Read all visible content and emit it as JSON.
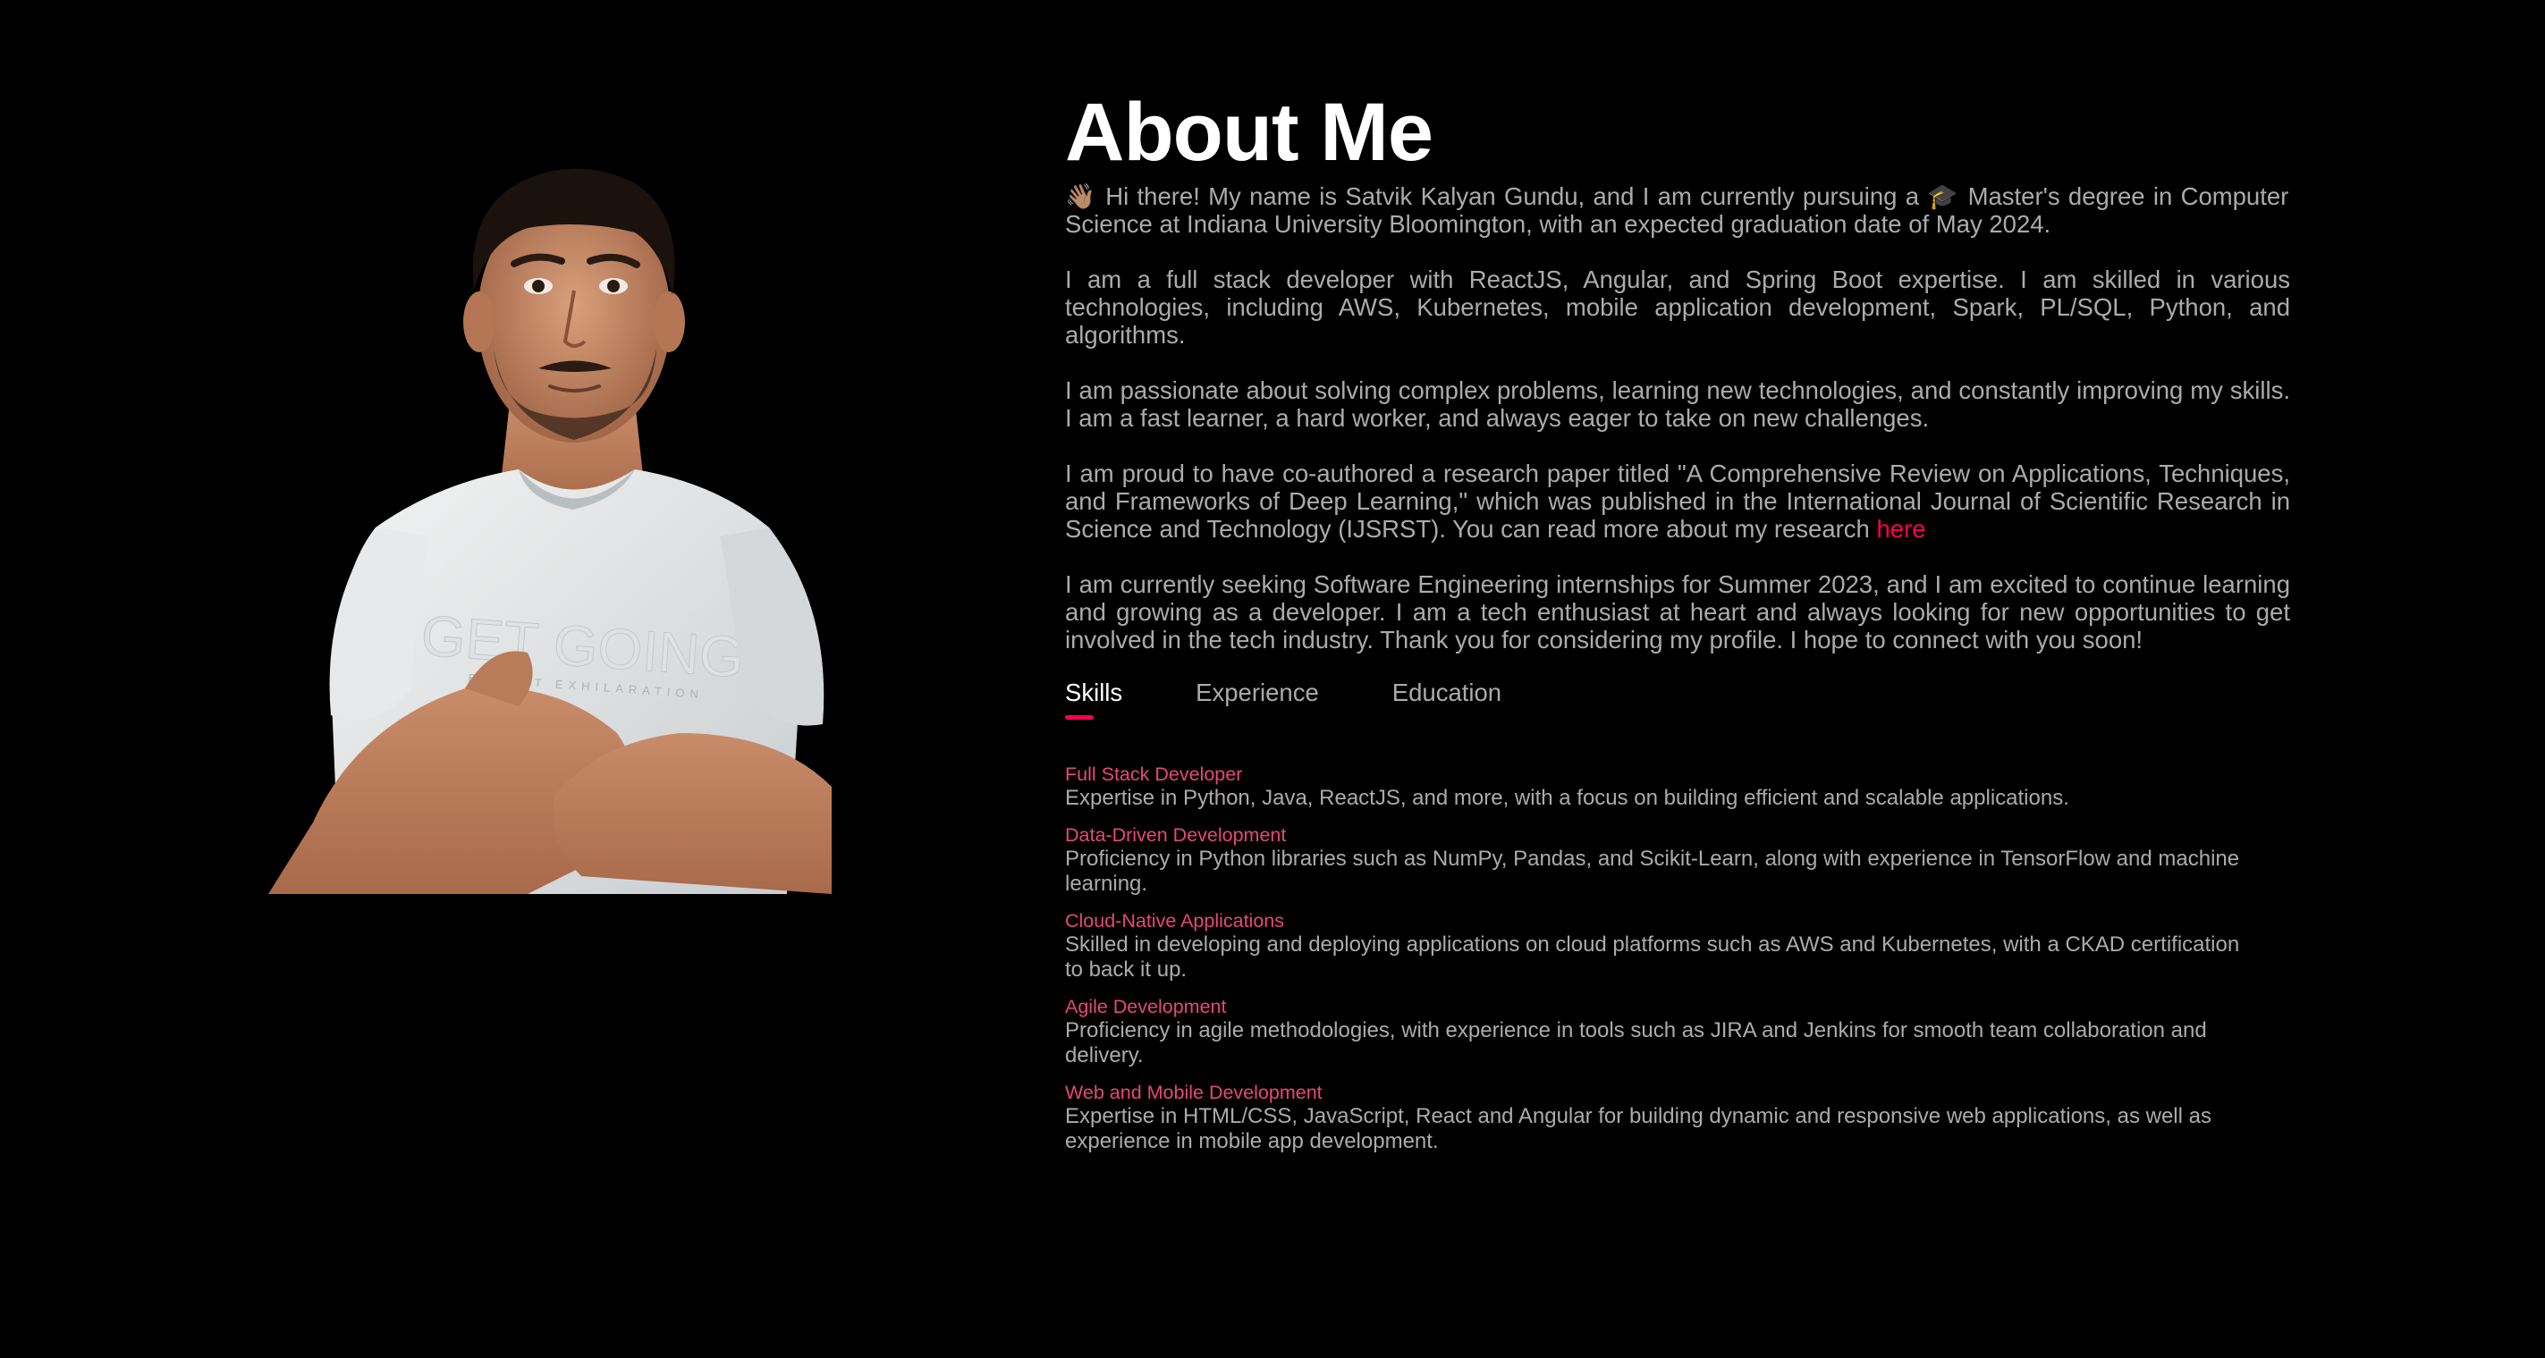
{
  "about": {
    "title": "About Me",
    "paragraphs": [
      "👋🏽 Hi there! My name is Satvik Kalyan Gundu, and I am currently pursuing a 🎓 Master's degree in Computer Science at Indiana University Bloomington, with an expected graduation date of May 2024.",
      "I am a full stack developer with ReactJS, Angular, and Spring Boot expertise. I am skilled in various technologies, including AWS, Kubernetes, mobile application development, Spark, PL/SQL, Python, and algorithms.",
      "I am passionate about solving complex problems, learning new technologies, and constantly improving my skills. I am a fast learner, a hard worker, and always eager to take on new challenges.",
      "I am proud to have co-authored a research paper titled \"A Comprehensive Review on Applications, Techniques, and Frameworks of Deep Learning,\" which was published in the International Journal of Scientific Research in Science and Technology (IJSRST). You can read more about my research ",
      "I am currently seeking Software Engineering internships for Summer 2023, and I am excited to continue learning and growing as a developer. I am a tech enthusiast at heart and always looking for new opportunities to get involved in the tech industry. Thank you for considering my profile. I hope to connect with you soon!"
    ],
    "research_link_label": "here"
  },
  "portrait": {
    "shirt_text": "GET GOING",
    "shirt_subtext": "EXPECT EXHILARATION"
  },
  "tabs": [
    {
      "label": "Skills",
      "active": true
    },
    {
      "label": "Experience",
      "active": false
    },
    {
      "label": "Education",
      "active": false
    }
  ],
  "skills": [
    {
      "title": "Full Stack Developer",
      "description": "Expertise in Python, Java, ReactJS, and more, with a focus on building efficient and scalable applications."
    },
    {
      "title": "Data-Driven Development",
      "description": "Proficiency in Python libraries such as NumPy, Pandas, and Scikit-Learn, along with experience in TensorFlow and machine learning."
    },
    {
      "title": "Cloud-Native Applications",
      "description": "Skilled in developing and deploying applications on cloud platforms such as AWS and Kubernetes, with a CKAD certification to back it up."
    },
    {
      "title": "Agile Development",
      "description": "Proficiency in agile methodologies, with experience in tools such as JIRA and Jenkins for smooth team collaboration and delivery."
    },
    {
      "title": "Web and Mobile Development",
      "description": "Expertise in HTML/CSS, JavaScript, React and Angular for building dynamic and responsive web applications, as well as experience in mobile app development."
    }
  ],
  "colors": {
    "background": "#000000",
    "accent": "#ff004f",
    "skill_title": "#e6487a",
    "body_text": "#ababab",
    "heading": "#ffffff"
  }
}
